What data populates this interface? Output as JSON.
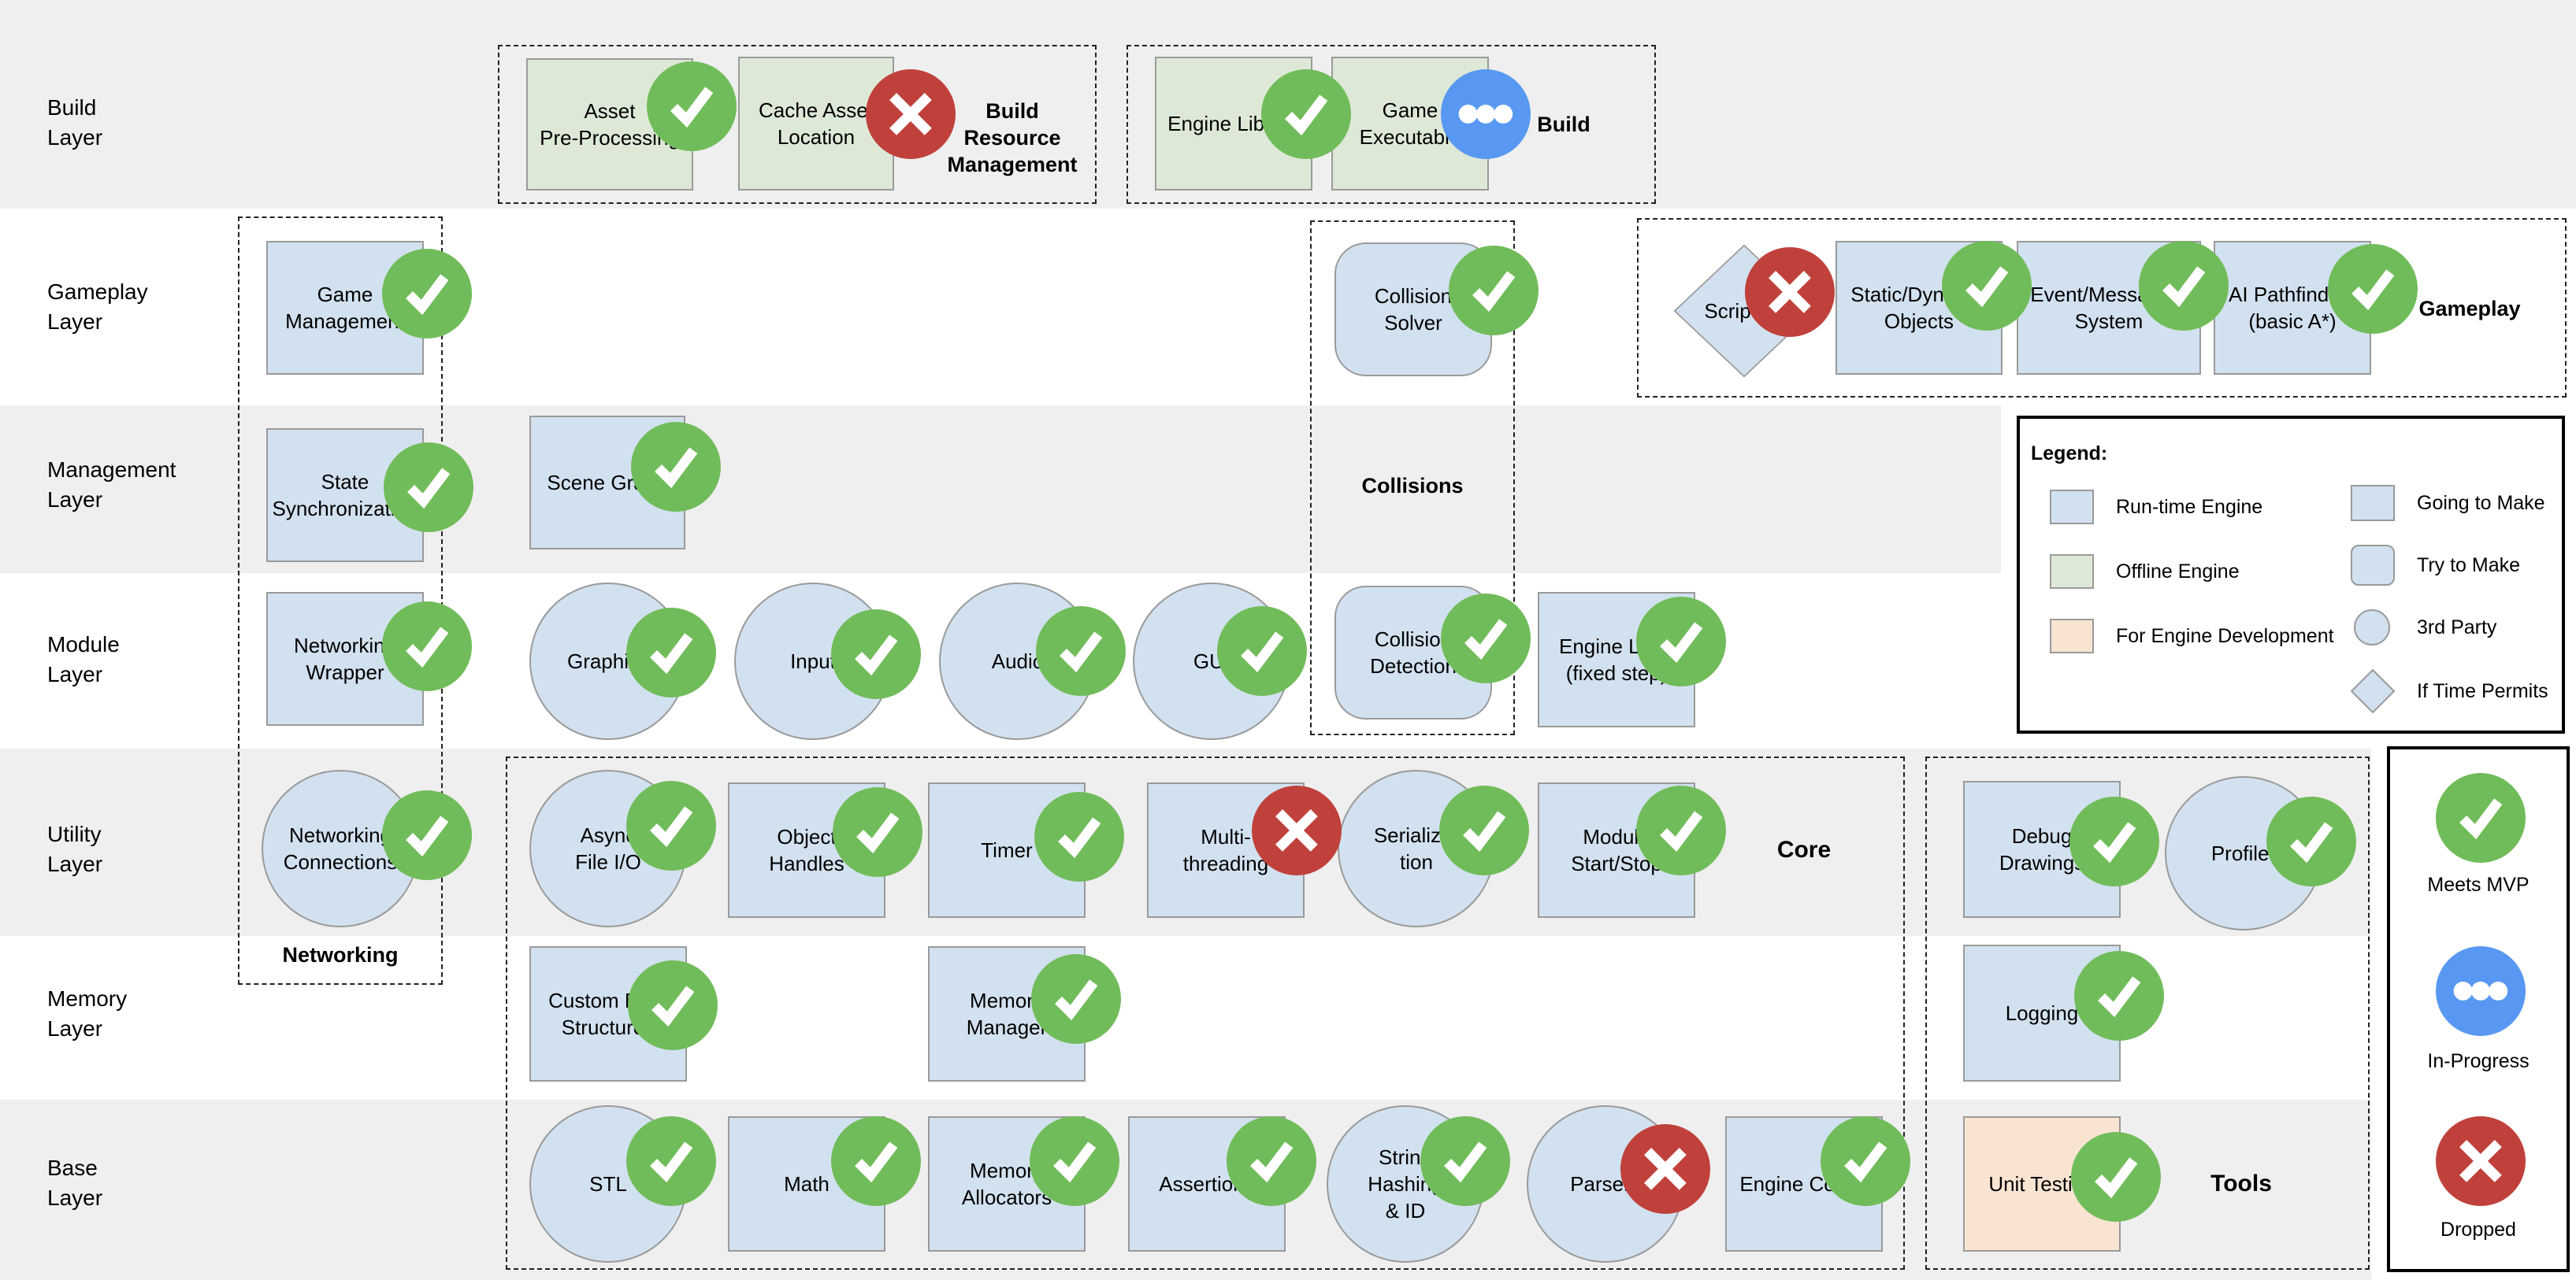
{
  "layers": [
    {
      "label": "Build\nLayer"
    },
    {
      "label": "Gameplay\nLayer"
    },
    {
      "label": "Management\nLayer"
    },
    {
      "label": "Module\nLayer"
    },
    {
      "label": "Utility\nLayer"
    },
    {
      "label": "Memory\nLayer"
    },
    {
      "label": "Base\nLayer"
    }
  ],
  "groups": {
    "build_resource_management": "Build Resource\nManagement",
    "build": "Build",
    "networking": "Networking",
    "collisions": "Collisions",
    "gameplay": "Gameplay",
    "core": "Core",
    "tools": "Tools"
  },
  "nodes": {
    "asset_preprocessing": {
      "label": "Asset\nPre-Processing",
      "category": "Offline Engine",
      "status": "meets-mvp"
    },
    "cache_asset_location": {
      "label": "Cache Asset\nLocation",
      "category": "Offline Engine",
      "status": "dropped"
    },
    "engine_library": {
      "label": "Engine Library",
      "category": "Offline Engine",
      "status": "meets-mvp"
    },
    "game_executable": {
      "label": "Game\nExecutable",
      "category": "Offline Engine",
      "status": "in-progress"
    },
    "game_management": {
      "label": "Game\nManagement",
      "category": "Run-time Engine",
      "status": "meets-mvp"
    },
    "collision_solver": {
      "label": "Collision\nSolver",
      "category": "Run-time Engine",
      "shape": "Try to Make",
      "status": "meets-mvp"
    },
    "scripting": {
      "label": "Scripting",
      "category": "Run-time Engine",
      "shape": "If Time Permits",
      "status": "dropped"
    },
    "static_dynamic_objects": {
      "label": "Static/Dynamic\nObjects",
      "category": "Run-time Engine",
      "status": "meets-mvp"
    },
    "event_messaging": {
      "label": "Event/Messaging\nSystem",
      "category": "Run-time Engine",
      "status": "meets-mvp"
    },
    "ai_pathfinding": {
      "label": "AI Pathfinding\n(basic A*)",
      "category": "Run-time Engine",
      "status": "meets-mvp"
    },
    "state_sync": {
      "label": "State\nSynchronization",
      "category": "Run-time Engine",
      "status": "meets-mvp"
    },
    "scene_graph": {
      "label": "Scene Graph",
      "category": "Run-time Engine",
      "status": "meets-mvp"
    },
    "networking_wrapper": {
      "label": "Networking\nWrapper",
      "category": "Run-time Engine",
      "status": "meets-mvp"
    },
    "graphics": {
      "label": "Graphics",
      "category": "Run-time Engine",
      "shape": "3rd Party",
      "status": "meets-mvp"
    },
    "input": {
      "label": "Input",
      "category": "Run-time Engine",
      "shape": "3rd Party",
      "status": "meets-mvp"
    },
    "audio": {
      "label": "Audio",
      "category": "Run-time Engine",
      "shape": "3rd Party",
      "status": "meets-mvp"
    },
    "gui": {
      "label": "GUI",
      "category": "Run-time Engine",
      "shape": "3rd Party",
      "status": "meets-mvp"
    },
    "collision_detection": {
      "label": "Collision\nDetection",
      "category": "Run-time Engine",
      "shape": "Try to Make",
      "status": "meets-mvp"
    },
    "engine_loop": {
      "label": "Engine Loop\n(fixed step)",
      "category": "Run-time Engine",
      "status": "meets-mvp"
    },
    "networking_connections": {
      "label": "Networking\nConnections",
      "category": "Run-time Engine",
      "shape": "3rd Party",
      "status": "meets-mvp"
    },
    "async_file_io": {
      "label": "Async\nFile I/O",
      "category": "Run-time Engine",
      "shape": "3rd Party",
      "status": "meets-mvp"
    },
    "object_handles": {
      "label": "Object\nHandles",
      "category": "Run-time Engine",
      "status": "meets-mvp"
    },
    "timer": {
      "label": "Timer",
      "category": "Run-time Engine",
      "status": "meets-mvp"
    },
    "multithreading": {
      "label": "Multi-\nthreading",
      "category": "Run-time Engine",
      "status": "dropped"
    },
    "serialization": {
      "label": "Serializa-\ntion",
      "category": "Run-time Engine",
      "shape": "3rd Party",
      "status": "meets-mvp"
    },
    "module_start_stop": {
      "label": "Module\nStart/Stop",
      "category": "Run-time Engine",
      "status": "meets-mvp"
    },
    "debug_drawings": {
      "label": "Debug\nDrawings",
      "category": "Run-time Engine",
      "status": "meets-mvp"
    },
    "profiler": {
      "label": "Profiler",
      "category": "Run-time Engine",
      "shape": "3rd Party",
      "status": "meets-mvp"
    },
    "custom_data_structures": {
      "label": "Custom Data\nStructures",
      "category": "Run-time Engine",
      "status": "meets-mvp"
    },
    "memory_manager": {
      "label": "Memory\nManager",
      "category": "Run-time Engine",
      "status": "meets-mvp"
    },
    "logging": {
      "label": "Logging",
      "category": "Run-time Engine",
      "status": "meets-mvp"
    },
    "stl": {
      "label": "STL",
      "category": "Run-time Engine",
      "shape": "3rd Party",
      "status": "meets-mvp"
    },
    "math": {
      "label": "Math",
      "category": "Run-time Engine",
      "status": "meets-mvp"
    },
    "memory_allocators": {
      "label": "Memory\nAllocators",
      "category": "Run-time Engine",
      "status": "meets-mvp"
    },
    "assertions": {
      "label": "Assertions",
      "category": "Run-time Engine",
      "status": "meets-mvp"
    },
    "string_hashing": {
      "label": "String\nHashing\n& ID",
      "category": "Run-time Engine",
      "shape": "3rd Party",
      "status": "meets-mvp"
    },
    "parsers": {
      "label": "Parsers",
      "category": "Run-time Engine",
      "shape": "3rd Party",
      "status": "dropped"
    },
    "engine_config": {
      "label": "Engine Config",
      "category": "Run-time Engine",
      "status": "meets-mvp"
    },
    "unit_testing": {
      "label": "Unit Testing",
      "category": "For Engine Development",
      "status": "meets-mvp"
    }
  },
  "legend": {
    "title": "Legend:",
    "categories": [
      {
        "label": "Run-time Engine",
        "color": "#d2e1ef"
      },
      {
        "label": "Offline Engine",
        "color": "#dde9d6"
      },
      {
        "label": "For Engine Development",
        "color": "#f9e4d2"
      }
    ],
    "shapes": [
      {
        "label": "Going to Make",
        "shape": "square"
      },
      {
        "label": "Try to Make",
        "shape": "rounded"
      },
      {
        "label": "3rd Party",
        "shape": "circle"
      },
      {
        "label": "If Time Permits",
        "shape": "diamond"
      }
    ]
  },
  "status_legend": [
    {
      "label": "Meets MVP",
      "icon": "check-icon",
      "color": "#71bc5a"
    },
    {
      "label": "In-Progress",
      "icon": "ellipsis-icon",
      "color": "#5898f2"
    },
    {
      "label": "Dropped",
      "icon": "cross-icon",
      "color": "#c0413b"
    }
  ]
}
